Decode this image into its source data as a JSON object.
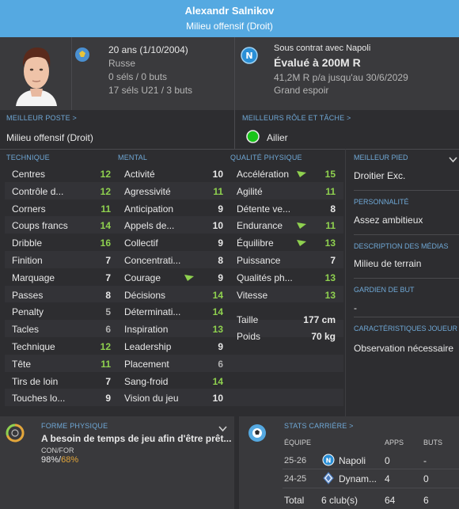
{
  "header": {
    "player_name": "Alexandr Salnikov",
    "position": "Milieu offensif (Droit)"
  },
  "info": {
    "age": "20 ans (1/10/2004)",
    "nationality": "Russe",
    "caps": "0 séls / 0 buts",
    "u21_caps": "17 séls U21 / 3 buts",
    "contract": "Sous contrat avec Napoli",
    "value": "Évalué à 200M R",
    "wage": "41,2M R p/a jusqu'au 30/6/2029",
    "status": "Grand espoir"
  },
  "best_position": {
    "label": "MEILLEUR POSTE >",
    "value": "Milieu offensif (Droit)"
  },
  "best_role": {
    "label": "MEILLEURS RÔLE ET TÂCHE >",
    "value": "Ailier"
  },
  "technical": {
    "label": "TECHNIQUE",
    "rows": [
      {
        "name": "Centres",
        "value": "12",
        "tone": "green"
      },
      {
        "name": "Contrôle d...",
        "value": "12",
        "tone": "green"
      },
      {
        "name": "Corners",
        "value": "11",
        "tone": "green"
      },
      {
        "name": "Coups francs",
        "value": "14",
        "tone": "green"
      },
      {
        "name": "Dribble",
        "value": "16",
        "tone": "green"
      },
      {
        "name": "Finition",
        "value": "7",
        "tone": "white"
      },
      {
        "name": "Marquage",
        "value": "7",
        "tone": "white"
      },
      {
        "name": "Passes",
        "value": "8",
        "tone": "white"
      },
      {
        "name": "Penalty",
        "value": "5",
        "tone": "grey"
      },
      {
        "name": "Tacles",
        "value": "6",
        "tone": "grey"
      },
      {
        "name": "Technique",
        "value": "12",
        "tone": "green"
      },
      {
        "name": "Tête",
        "value": "11",
        "tone": "green"
      },
      {
        "name": "Tirs de loin",
        "value": "7",
        "tone": "white"
      },
      {
        "name": "Touches lo...",
        "value": "9",
        "tone": "white"
      }
    ]
  },
  "mental": {
    "label": "MENTAL",
    "rows": [
      {
        "name": "Activité",
        "value": "10",
        "tone": "white"
      },
      {
        "name": "Agressivité",
        "value": "11",
        "tone": "green"
      },
      {
        "name": "Anticipation",
        "value": "9",
        "tone": "white"
      },
      {
        "name": "Appels de...",
        "value": "10",
        "tone": "white"
      },
      {
        "name": "Collectif",
        "value": "9",
        "tone": "white"
      },
      {
        "name": "Concentrati...",
        "value": "8",
        "tone": "white"
      },
      {
        "name": "Courage",
        "value": "9",
        "tone": "white"
      },
      {
        "name": "Décisions",
        "value": "14",
        "tone": "green"
      },
      {
        "name": "Déterminati...",
        "value": "14",
        "tone": "green"
      },
      {
        "name": "Inspiration",
        "value": "13",
        "tone": "green"
      },
      {
        "name": "Leadership",
        "value": "9",
        "tone": "white"
      },
      {
        "name": "Placement",
        "value": "6",
        "tone": "grey"
      },
      {
        "name": "Sang-froid",
        "value": "14",
        "tone": "green"
      },
      {
        "name": "Vision du jeu",
        "value": "10",
        "tone": "white"
      }
    ]
  },
  "physical": {
    "label": "QUALITÉ PHYSIQUE",
    "rows": [
      {
        "name": "Accélération",
        "value": "15",
        "tone": "green"
      },
      {
        "name": "Agilité",
        "value": "11",
        "tone": "green"
      },
      {
        "name": "Détente ve...",
        "value": "8",
        "tone": "white"
      },
      {
        "name": "Endurance",
        "value": "11",
        "tone": "green"
      },
      {
        "name": "Équilibre",
        "value": "13",
        "tone": "green"
      },
      {
        "name": "Puissance",
        "value": "7",
        "tone": "white"
      },
      {
        "name": "Qualités ph...",
        "value": "13",
        "tone": "green"
      },
      {
        "name": "Vitesse",
        "value": "13",
        "tone": "green"
      }
    ],
    "height_label": "Taille",
    "height_value": "177 cm",
    "weight_label": "Poids",
    "weight_value": "70 kg"
  },
  "side": {
    "foot_label": "MEILLEUR PIED",
    "foot_value": "Droitier Exc.",
    "personality_label": "PERSONNALITÉ",
    "personality_value": "Assez ambitieux",
    "media_label": "DESCRIPTION DES MÉDIAS",
    "media_value": "Milieu de terrain",
    "keeper_label": "GARDIEN DE BUT",
    "keeper_value": "-",
    "traits_label": "CARACTÉRISTIQUES JOUEUR",
    "traits_value": "Observation nécessaire"
  },
  "fitness": {
    "label": "FORME PHYSIQUE",
    "text": "A besoin de temps de jeu afin d'être prêt...",
    "sub_label": "CON/FOR",
    "condition": "98%",
    "separator": "/",
    "match_fitness": "68%"
  },
  "career": {
    "label": "STATS CARRIÈRE >",
    "col_team": "ÉQUIPE",
    "col_apps": "APPS",
    "col_goals": "BUTS",
    "rows": [
      {
        "season": "25-26",
        "team": "Napoli",
        "apps": "0",
        "goals": "-"
      },
      {
        "season": "24-25",
        "team": "Dynam...",
        "apps": "4",
        "goals": "0"
      }
    ],
    "total_label": "Total",
    "total_clubs": "6 club(s)",
    "total_apps": "64",
    "total_goals": "6"
  },
  "colors": {
    "header": "#55a9e1",
    "accent_label": "#6fa8d6",
    "good": "#8fd14f",
    "role_dot": "#19c41a",
    "match_fitness": "#e3a63a"
  }
}
